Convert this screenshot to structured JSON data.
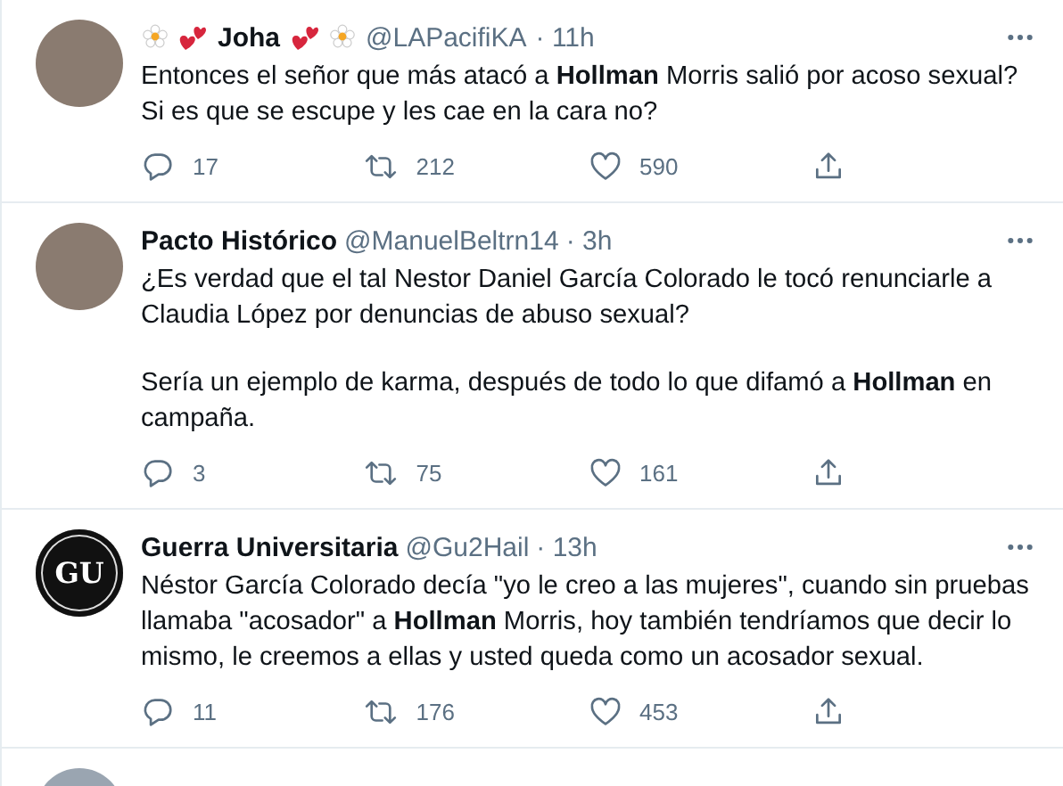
{
  "tweets": [
    {
      "kind": "photo",
      "name": "Joha",
      "decorated": true,
      "handle": "@LAPacifiKA",
      "time": "· 11h",
      "paragraphs": [
        "Entonces el señor que más atacó a **Hollman** Morris salió por acoso sexual? Si es que se escupe y les cae en la cara no?"
      ],
      "replies": "17",
      "retweets": "212",
      "likes": "590"
    },
    {
      "kind": "photo",
      "name": "Pacto Histórico",
      "decorated": false,
      "handle": "@ManuelBeltrn14",
      "time": "· 3h",
      "paragraphs": [
        "¿Es verdad que el tal Nestor Daniel García Colorado le tocó renunciarle a Claudia López por denuncias de abuso sexual?",
        "Sería un ejemplo de karma, después de todo lo que difamó a **Hollman** en campaña."
      ],
      "replies": "3",
      "retweets": "75",
      "likes": "161"
    },
    {
      "kind": "logo",
      "logo_text": "GU",
      "name": "Guerra Universitaria",
      "decorated": false,
      "handle": "@Gu2Hail",
      "time": "· 13h",
      "paragraphs": [
        "Néstor García Colorado decía \"yo le creo a las mujeres\", cuando sin pruebas llamaba \"acosador\" a **Hollman** Morris, hoy también tendríamos que decir lo mismo, le creemos a ellas y usted queda como un acosador sexual."
      ],
      "replies": "11",
      "retweets": "176",
      "likes": "453"
    }
  ]
}
